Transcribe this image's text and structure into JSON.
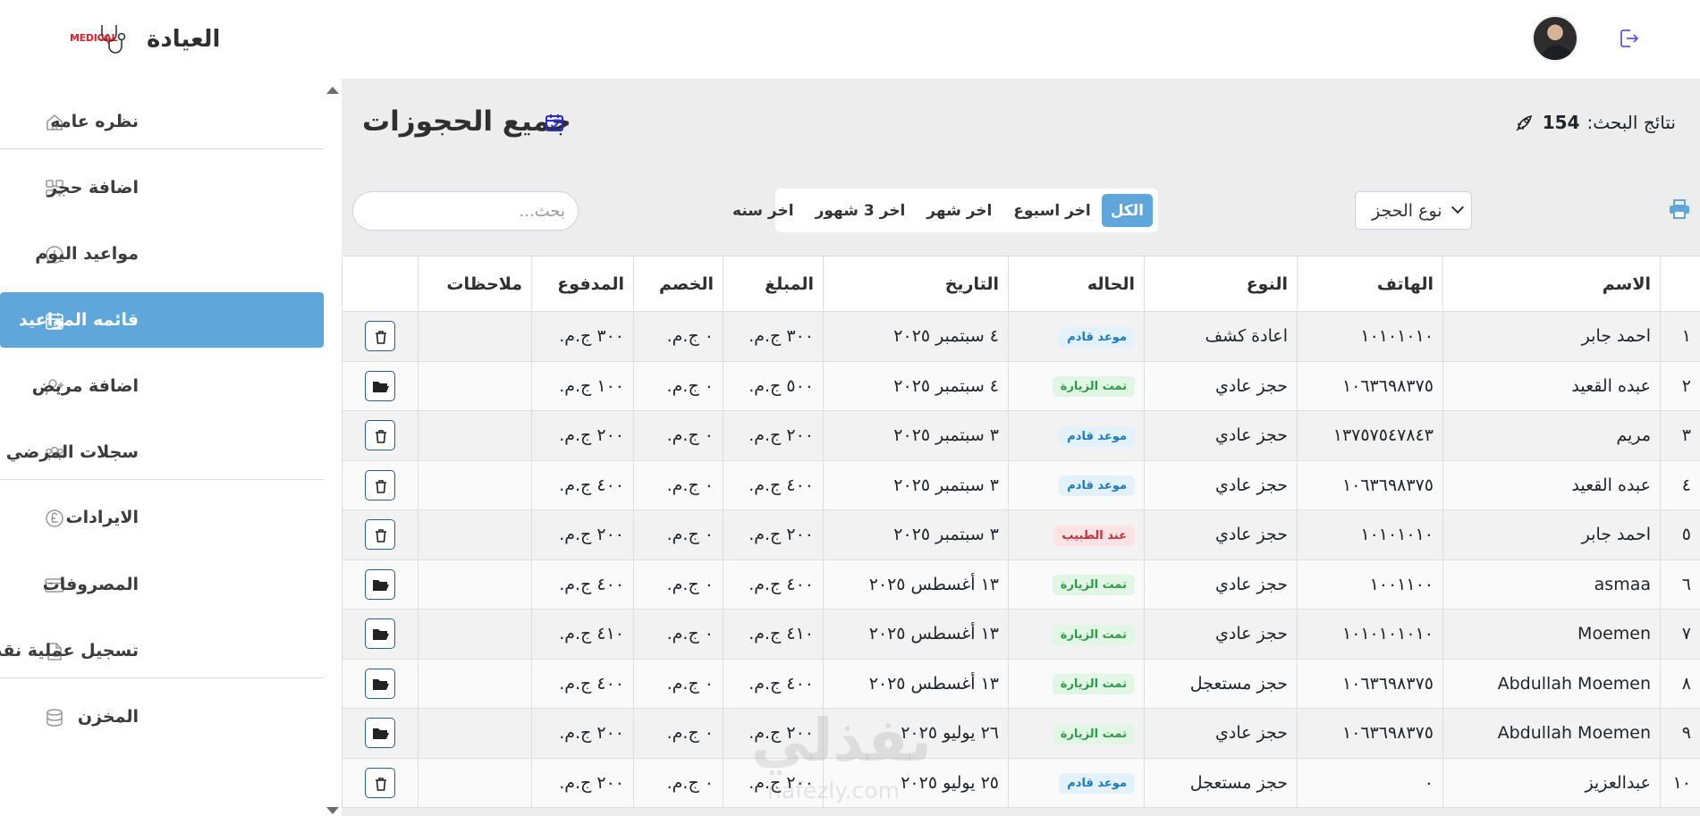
{
  "app": {
    "brand_logo_text": "MEDICAL",
    "brand_name": "العيادة"
  },
  "sidebar": {
    "items": [
      {
        "label": "نظره عامه",
        "icon": "home-icon"
      },
      {
        "label": "اضافة حجز",
        "icon": "grid-plus-icon"
      },
      {
        "label": "مواعيد اليوم",
        "icon": "clock-icon"
      },
      {
        "label": "قائمه المواعيد",
        "icon": "calendar-icon",
        "active": true
      },
      {
        "label": "اضافة مريض",
        "icon": "user-plus-icon"
      },
      {
        "label": "سجلات المرضي",
        "icon": "users-icon"
      },
      {
        "label": "الايرادات",
        "icon": "pound-icon"
      },
      {
        "label": "المصروفات",
        "icon": "credit-card-icon"
      },
      {
        "label": "تسجيل عملية نقديه",
        "icon": "file-plus-icon"
      },
      {
        "label": "المخزن",
        "icon": "database-icon"
      }
    ]
  },
  "main": {
    "title": "جميع الحجوزات",
    "results_label": "نتائج البحث:",
    "results_count": "154",
    "booking_type_select": "نوع الحجز",
    "filters": [
      "الكل",
      "اخر اسبوع",
      "اخر شهر",
      "اخر 3 شهور",
      "اخر سنه"
    ],
    "active_filter": "الكل",
    "search_placeholder": "بحث..."
  },
  "table": {
    "headers": [
      "",
      "الاسم",
      "الهاتف",
      "النوع",
      "الحاله",
      "التاريخ",
      "المبلغ",
      "الخصم",
      "المدفوع",
      "ملاحظات",
      ""
    ],
    "rows": [
      {
        "n": "١",
        "name": "احمد جابر",
        "phone": "١٠١٠١٠١٠",
        "type": "اعادة كشف",
        "status": "موعد قادم",
        "status_kind": "upcoming",
        "date": "٤ سبتمبر ٢٠٢٥",
        "amount": "٣٠٠ ج.م.",
        "discount": "٠ ج.م.",
        "paid": "٣٠٠ ج.م.",
        "notes": "",
        "action": "trash-icon"
      },
      {
        "n": "٢",
        "name": "عبده القعيد",
        "phone": "١٠٦٣٦٩٨٣٧٥",
        "type": "حجز عادي",
        "status": "تمت الزيارة",
        "status_kind": "done",
        "date": "٤ سبتمبر ٢٠٢٥",
        "amount": "٥٠٠ ج.م.",
        "discount": "٠ ج.م.",
        "paid": "١٠٠ ج.م.",
        "notes": "",
        "action": "folder-open-icon"
      },
      {
        "n": "٣",
        "name": "مريم",
        "phone": "١٣٧٥٧٥٤٧٨٤٣",
        "type": "حجز عادي",
        "status": "موعد قادم",
        "status_kind": "upcoming",
        "date": "٣ سبتمبر ٢٠٢٥",
        "amount": "٢٠٠ ج.م.",
        "discount": "٠ ج.م.",
        "paid": "٢٠٠ ج.م.",
        "notes": "",
        "action": "trash-icon"
      },
      {
        "n": "٤",
        "name": "عبده القعيد",
        "phone": "١٠٦٣٦٩٨٣٧٥",
        "type": "حجز عادي",
        "status": "موعد قادم",
        "status_kind": "upcoming",
        "date": "٣ سبتمبر ٢٠٢٥",
        "amount": "٤٠٠ ج.م.",
        "discount": "٠ ج.م.",
        "paid": "٤٠٠ ج.م.",
        "notes": "",
        "action": "trash-icon"
      },
      {
        "n": "٥",
        "name": "احمد جابر",
        "phone": "١٠١٠١٠١٠",
        "type": "حجز عادي",
        "status": "عند الطبيب",
        "status_kind": "doctor",
        "date": "٣ سبتمبر ٢٠٢٥",
        "amount": "٢٠٠ ج.م.",
        "discount": "٠ ج.م.",
        "paid": "٢٠٠ ج.م.",
        "notes": "",
        "action": "trash-icon"
      },
      {
        "n": "٦",
        "name": "asmaa",
        "phone": "١٠٠١١٠٠",
        "type": "حجز عادي",
        "status": "تمت الزيارة",
        "status_kind": "done",
        "date": "١٣ أغسطس ٢٠٢٥",
        "amount": "٤٠٠ ج.م.",
        "discount": "٠ ج.م.",
        "paid": "٤٠٠ ج.م.",
        "notes": "",
        "action": "folder-open-icon"
      },
      {
        "n": "٧",
        "name": "Moemen",
        "phone": "١٠١٠١٠١٠١٠",
        "type": "حجز عادي",
        "status": "تمت الزيارة",
        "status_kind": "done",
        "date": "١٣ أغسطس ٢٠٢٥",
        "amount": "٤١٠ ج.م.",
        "discount": "٠ ج.م.",
        "paid": "٤١٠ ج.م.",
        "notes": "",
        "action": "folder-open-icon"
      },
      {
        "n": "٨",
        "name": "Abdullah Moemen",
        "phone": "١٠٦٣٦٩٨٣٧٥",
        "type": "حجز مستعجل",
        "status": "تمت الزيارة",
        "status_kind": "done",
        "date": "١٣ أغسطس ٢٠٢٥",
        "amount": "٤٠٠ ج.م.",
        "discount": "٠ ج.م.",
        "paid": "٤٠٠ ج.م.",
        "notes": "",
        "action": "folder-open-icon"
      },
      {
        "n": "٩",
        "name": "Abdullah Moemen",
        "phone": "١٠٦٣٦٩٨٣٧٥",
        "type": "حجز عادي",
        "status": "تمت الزيارة",
        "status_kind": "done",
        "date": "٢٦ يوليو ٢٠٢٥",
        "amount": "٢٠٠ ج.م.",
        "discount": "٠ ج.م.",
        "paid": "٢٠٠ ج.م.",
        "notes": "",
        "action": "folder-open-icon"
      },
      {
        "n": "١٠",
        "name": "عبدالعزيز",
        "phone": "٠",
        "type": "حجز مستعجل",
        "status": "موعد قادم",
        "status_kind": "upcoming",
        "date": "٢٥ يوليو ٢٠٢٥",
        "amount": "٢٠٠ ج.م.",
        "discount": "٠ ج.م.",
        "paid": "٢٠٠ ج.م.",
        "notes": "",
        "action": "trash-icon"
      }
    ]
  },
  "watermark": {
    "text": "نفذلي",
    "url_text": "nafezly.com"
  },
  "colors": {
    "accent": "#5fa6db",
    "upcoming_badge": "#1c7bbd",
    "done_badge": "#2f9a4b",
    "doctor_badge": "#c5303b"
  }
}
